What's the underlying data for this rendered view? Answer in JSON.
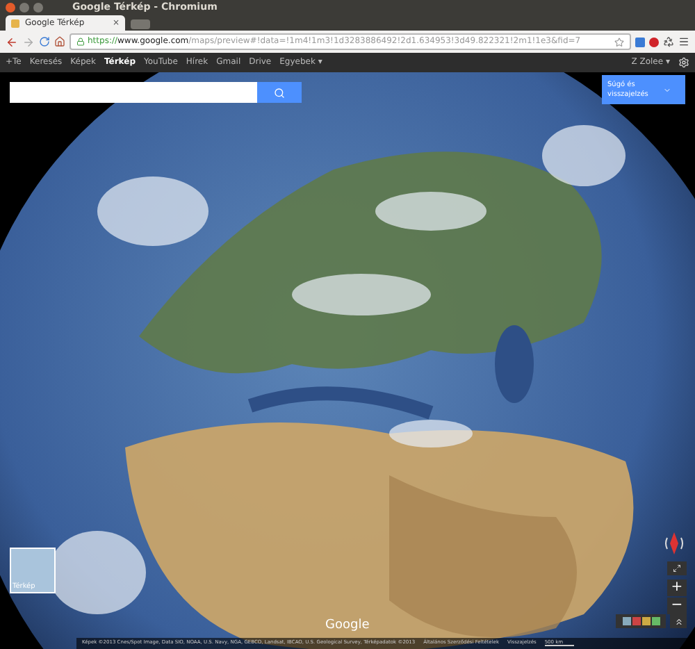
{
  "window": {
    "title": "Google Térkép - Chromium"
  },
  "tabs": [
    {
      "title": "Google Térkép",
      "selected": true,
      "close": "×"
    }
  ],
  "address_bar": {
    "scheme": "https://",
    "host": "www.google.com",
    "path": "/maps/preview#!data=!1m4!1m3!1d3283886492!2d1.634953!3d49.822321!2m1!1e3&fid=7"
  },
  "google_bar": {
    "items": [
      {
        "label": "+Te",
        "selected": false
      },
      {
        "label": "Keresés",
        "selected": false
      },
      {
        "label": "Képek",
        "selected": false
      },
      {
        "label": "Térkép",
        "selected": true
      },
      {
        "label": "YouTube",
        "selected": false
      },
      {
        "label": "Hírek",
        "selected": false
      },
      {
        "label": "Gmail",
        "selected": false
      },
      {
        "label": "Drive",
        "selected": false
      },
      {
        "label": "Egyebek ▾",
        "selected": false
      }
    ],
    "user": "Z Zolee ▾"
  },
  "map": {
    "help_button": "Súgó és visszajelzés",
    "zoom_in": "+",
    "zoom_out": "−",
    "thumbnail_label": "Térkép",
    "logo": "Google",
    "footer": {
      "attribution": "Képek ©2013 Cnes/Spot Image, Data SIO, NOAA, U.S. Navy, NGA, GEBCO, Landsat, IBCAO, U.S. Geological Survey, Térképadatok ©2013",
      "terms": "Általános Szerződési Feltételek",
      "feedback": "Visszajelzés",
      "scale": "500 km"
    }
  }
}
